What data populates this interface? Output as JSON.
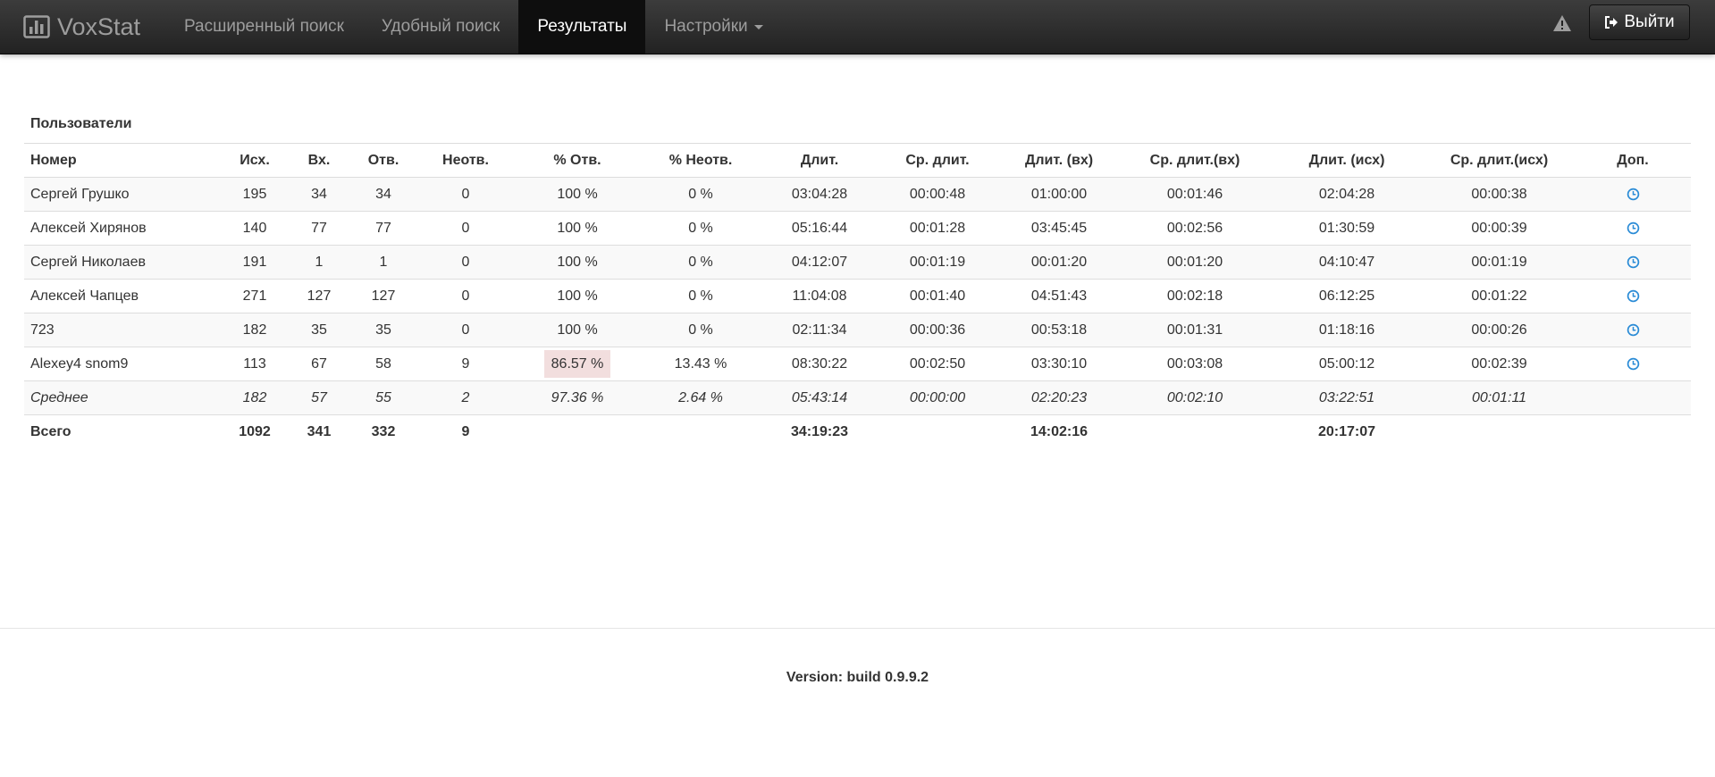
{
  "navbar": {
    "brand": "VoxStat",
    "items": [
      {
        "label": "Расширенный поиск"
      },
      {
        "label": "Удобный поиск"
      },
      {
        "label": "Результаты"
      },
      {
        "label": "Настройки"
      }
    ],
    "logout_label": "Выйти"
  },
  "section_title": "Пользователи",
  "table": {
    "headers": [
      "Номер",
      "Исх.",
      "Вх.",
      "Отв.",
      "Неотв.",
      "% Отв.",
      "% Неотв.",
      "Длит.",
      "Ср. длит.",
      "Длит. (вх)",
      "Ср. длит.(вх)",
      "Длит. (исх)",
      "Ср. длит.(исх)",
      "Доп."
    ],
    "rows": [
      [
        "Сергей Грушко",
        "195",
        "34",
        "34",
        "0",
        "100 %",
        "0 %",
        "03:04:28",
        "00:00:48",
        "01:00:00",
        "00:01:46",
        "02:04:28",
        "00:00:38"
      ],
      [
        "Алексей Хирянов",
        "140",
        "77",
        "77",
        "0",
        "100 %",
        "0 %",
        "05:16:44",
        "00:01:28",
        "03:45:45",
        "00:02:56",
        "01:30:59",
        "00:00:39"
      ],
      [
        "Сергей Николаев",
        "191",
        "1",
        "1",
        "0",
        "100 %",
        "0 %",
        "04:12:07",
        "00:01:19",
        "00:01:20",
        "00:01:20",
        "04:10:47",
        "00:01:19"
      ],
      [
        "Алексей Чапцев",
        "271",
        "127",
        "127",
        "0",
        "100 %",
        "0 %",
        "11:04:08",
        "00:01:40",
        "04:51:43",
        "00:02:18",
        "06:12:25",
        "00:01:22"
      ],
      [
        "723",
        "182",
        "35",
        "35",
        "0",
        "100 %",
        "0 %",
        "02:11:34",
        "00:00:36",
        "00:53:18",
        "00:01:31",
        "01:18:16",
        "00:00:26"
      ],
      [
        "Alexey4 snom9",
        "113",
        "67",
        "58",
        "9",
        "86.57 %",
        "13.43 %",
        "08:30:22",
        "00:02:50",
        "03:30:10",
        "00:03:08",
        "05:00:12",
        "00:02:39"
      ]
    ],
    "average": [
      "Среднее",
      "182",
      "57",
      "55",
      "2",
      "97.36 %",
      "2.64 %",
      "05:43:14",
      "00:00:00",
      "02:20:23",
      "00:02:10",
      "03:22:51",
      "00:01:11"
    ],
    "total": [
      "Всего",
      "1092",
      "341",
      "332",
      "9",
      "",
      "",
      "34:19:23",
      "",
      "14:02:16",
      "",
      "20:17:07",
      ""
    ],
    "highlight_color": "#f2dede",
    "action_icon": "clock-icon",
    "action_icon_color": "#2a8bd6"
  },
  "footer": {
    "version": "Version: build 0.9.9.2"
  }
}
